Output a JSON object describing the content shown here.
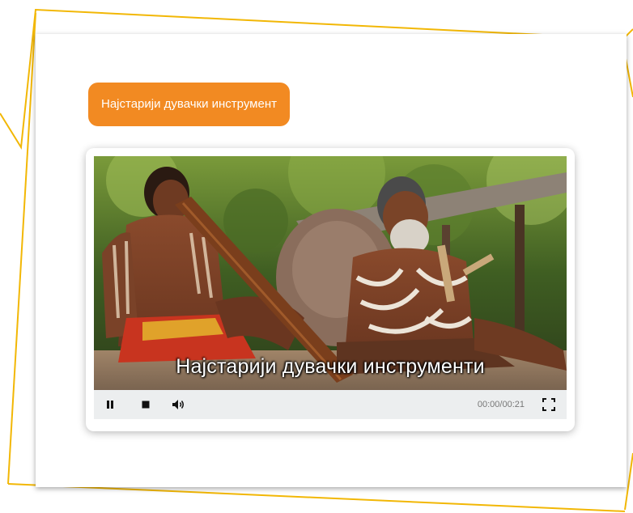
{
  "card": {
    "title": "Најстарији дувачки инструмент"
  },
  "player": {
    "subtitle": "Најстарији дувачки инструменти",
    "time_display": "00:00/00:21",
    "controls": {
      "pause_icon": "pause-icon",
      "stop_icon": "stop-icon",
      "volume_icon": "volume-icon",
      "fullscreen_icon": "fullscreen-icon"
    }
  },
  "colors": {
    "title_background": "#f28a22",
    "decorative_lines": "#f2b705",
    "controls_background": "#eceeef"
  }
}
